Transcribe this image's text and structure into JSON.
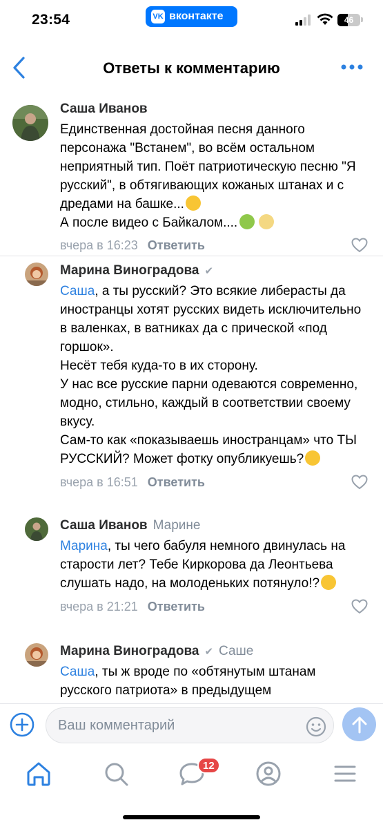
{
  "status_bar": {
    "time": "23:54",
    "app_pill": "вконтакте",
    "battery_level": "46"
  },
  "header": {
    "title": "Ответы к комментарию"
  },
  "comments": [
    {
      "author": "Саша Иванов",
      "reply_to": "",
      "mention": "",
      "text": "Единственная достойная песня данного персонажа \"Встанем\", во всём остальном неприятный тип. Поёт патриотическую песню \"Я русский\", в обтягивающих кожаных штанах и с дредами на башке...",
      "text_tail": "А после видео с Байкалом....",
      "date": "вчера в 16:23",
      "reply_label": "Ответить"
    },
    {
      "author": "Марина Виноградова",
      "reply_to": "",
      "mention": "Саша",
      "text": ", а ты русский? Это всякие либерасты да иностранцы хотят русских видеть исключительно в валенках, в ватниках да с прической «под горшок».\nНесёт тебя куда-то в их сторону.\nУ нас все русские парни одеваются современно, модно, стильно, каждый в соответствии своему вкусу.\nСам-то как «показываешь иностранцам» что ТЫ РУССКИЙ? Может фотку опубликуешь?",
      "date": "вчера в 16:51",
      "reply_label": "Ответить"
    },
    {
      "author": "Саша Иванов",
      "reply_to": "Марине",
      "mention": "Марина",
      "text": ", ты чего бабуля немного двинулась на старости лет? Тебе Киркорова да Леонтьева слушать надо, на молоденьких потянуло!?",
      "date": "вчера в 21:21",
      "reply_label": "Ответить"
    },
    {
      "author": "Марина Виноградова",
      "reply_to": "Саше",
      "mention": "Саша",
      "text": ", ты ж вроде по «обтянутым штанам русского патриота» в предыдущем",
      "date": "",
      "reply_label": ""
    }
  ],
  "composer": {
    "placeholder": "Ваш комментарий"
  },
  "tabbar": {
    "messages_badge": "12"
  },
  "colors": {
    "accent": "#2d81e0",
    "vk_blue": "#0077ff",
    "badge_red": "#e64646"
  }
}
